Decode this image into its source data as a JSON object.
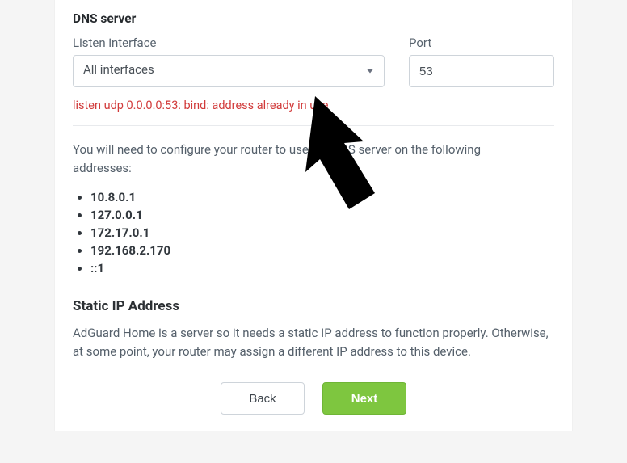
{
  "heading": "DNS server",
  "interface": {
    "label": "Listen interface",
    "value": "All interfaces"
  },
  "port": {
    "label": "Port",
    "value": "53"
  },
  "error": "listen udp 0.0.0.0:53: bind: address already in use",
  "instruction_pre": "You will need to configure your ",
  "instruction_mid": " router to use the DNS server on the following",
  "instruction_end": "addresses:",
  "addresses": [
    "10.8.0.1",
    "127.0.0.1",
    "172.17.0.1",
    "192.168.2.170",
    "::1"
  ],
  "static": {
    "title": "Static IP Address",
    "body": "AdGuard Home is a server so it needs a static IP address to function properly. Otherwise, at some point, your router may assign a different IP address to this device."
  },
  "buttons": {
    "back": "Back",
    "next": "Next"
  }
}
